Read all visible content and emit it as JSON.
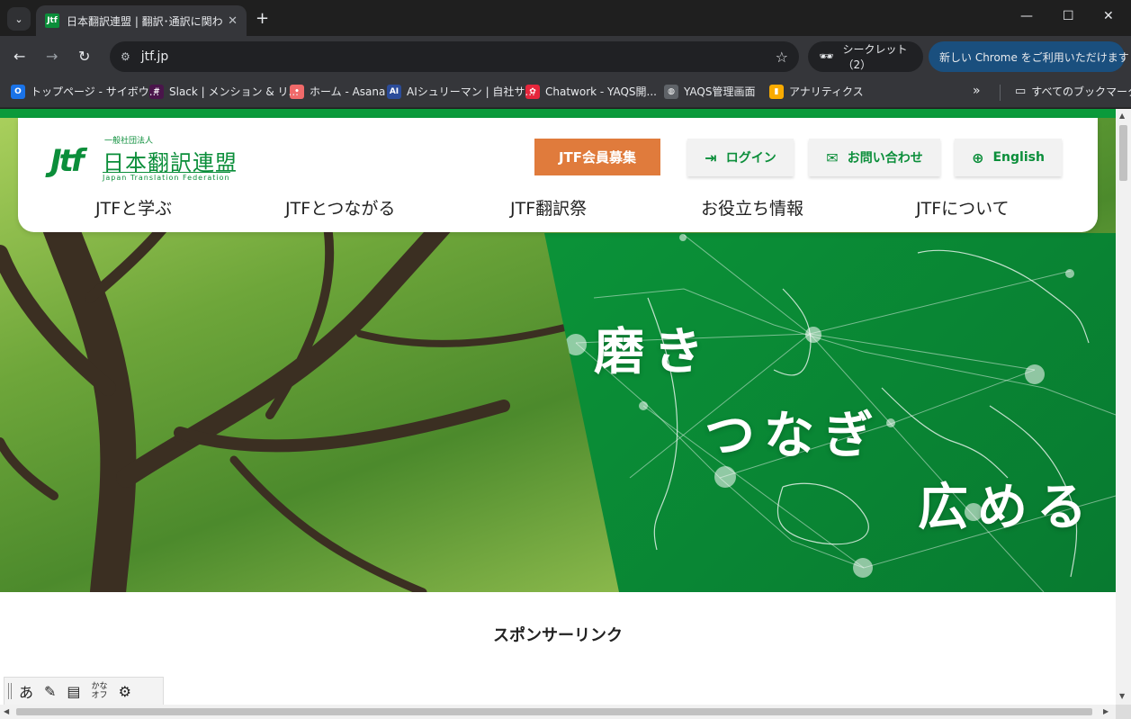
{
  "browser": {
    "tab_title": "日本翻訳連盟 | 翻訳･通訳に関わ",
    "favicon_text": "Jtf",
    "new_tab": "+",
    "close_tab": "✕",
    "url": "jtf.jp",
    "incognito_label": "シークレット（2）",
    "update_label": "新しい Chrome をご利用いただけます",
    "update_more": "⋮",
    "bookmarks": [
      {
        "label": "トップページ - サイボウ...",
        "icon": "cybozu-icon",
        "color": "#1a73e8",
        "glyph": "O"
      },
      {
        "label": "Slack | メンション & リ...",
        "icon": "slack-icon",
        "color": "#4a154b",
        "glyph": "#"
      },
      {
        "label": "ホーム - Asana",
        "icon": "asana-icon",
        "color": "#f06a6a",
        "glyph": "•"
      },
      {
        "label": "AIシュリーマン | 自社サ...",
        "icon": "ai-icon",
        "color": "#2b4c9a",
        "glyph": "AI"
      },
      {
        "label": "Chatwork - YAQS開...",
        "icon": "chatwork-icon",
        "color": "#e6263c",
        "glyph": "✿"
      },
      {
        "label": "YAQS管理画面",
        "icon": "globe-icon",
        "color": "#5f6368",
        "glyph": "◍"
      },
      {
        "label": "アナリティクス",
        "icon": "analytics-icon",
        "color": "#f9ab00",
        "glyph": "▮"
      }
    ],
    "bookmarks_more": "»",
    "all_bookmarks": "すべてのブックマーク"
  },
  "site": {
    "logo": {
      "small": "一般社団法人",
      "mark": "Jtf",
      "name": "日本翻訳連盟",
      "english": "Japan Translation Federation"
    },
    "member_button": "JTF会員募集",
    "utility": [
      {
        "label": "ログイン",
        "icon": "login-icon",
        "glyph": "⇥"
      },
      {
        "label": "お問い合わせ",
        "icon": "mail-icon",
        "glyph": "✉"
      },
      {
        "label": "English",
        "icon": "globe-icon",
        "glyph": "⊕"
      }
    ],
    "nav": [
      "JTFと学ぶ",
      "JTFとつながる",
      "JTF翻訳祭",
      "お役立ち情報",
      "JTFについて"
    ],
    "tagline": [
      "磨き",
      "つなぎ",
      "広める"
    ],
    "sponsor_title": "スポンサーリンク"
  },
  "ime": {
    "items": [
      {
        "glyph": "あ",
        "icon": "ime-mode-icon"
      },
      {
        "glyph": "✎",
        "icon": "ime-pad-icon"
      },
      {
        "glyph": "▤",
        "icon": "ime-dictionary-icon"
      }
    ],
    "kana_top": "かな",
    "kana_bottom": "オフ",
    "settings_glyph": "⚙"
  },
  "colors": {
    "brand_green": "#0b8e3a",
    "member_orange": "#e07b3c"
  }
}
